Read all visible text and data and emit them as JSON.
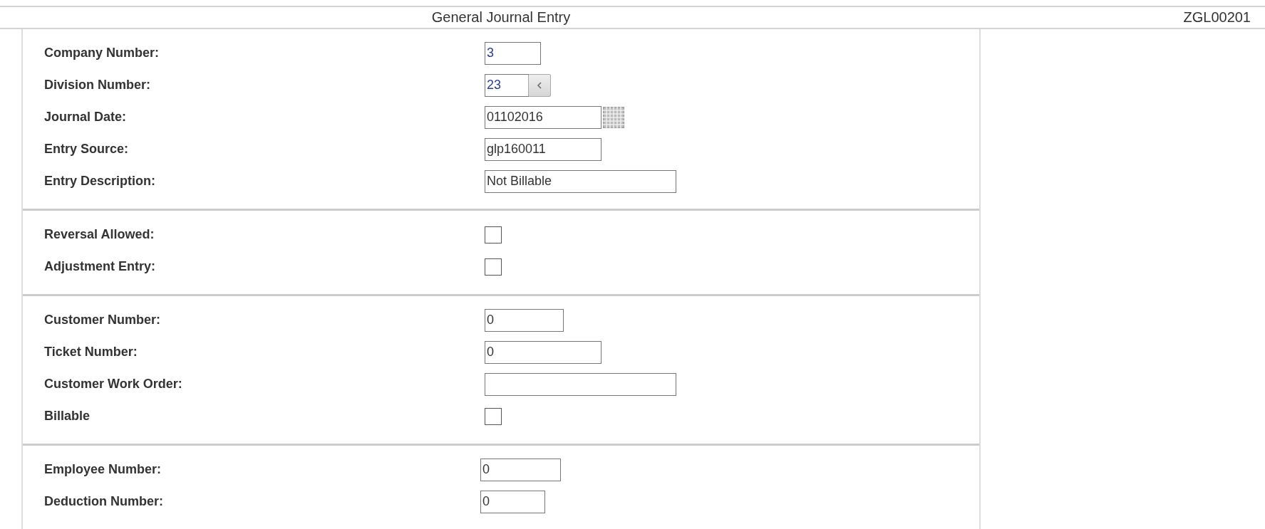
{
  "header": {
    "title": "General Journal Entry",
    "program_id": "ZGL00201"
  },
  "sections": [
    {
      "fields": [
        {
          "label": "Company Number:",
          "kind": "key",
          "value": "3"
        },
        {
          "label": "Division Number:",
          "kind": "lookup",
          "value": "23"
        },
        {
          "label": "Journal Date:",
          "kind": "date",
          "value": "01102016"
        },
        {
          "label": "Entry Source:",
          "kind": "text",
          "value": "glp160011"
        },
        {
          "label": "Entry Description:",
          "kind": "text",
          "value": "Not Billable"
        }
      ]
    },
    {
      "fields": [
        {
          "label": "Reversal Allowed:",
          "kind": "checkbox",
          "checked": false
        },
        {
          "label": "Adjustment Entry:",
          "kind": "checkbox",
          "checked": false
        }
      ]
    },
    {
      "fields": [
        {
          "label": "Customer Number:",
          "kind": "text",
          "value": "0"
        },
        {
          "label": "Ticket Number:",
          "kind": "text",
          "value": "0"
        },
        {
          "label": "Customer Work Order:",
          "kind": "text"
        },
        {
          "label": "Billable",
          "kind": "checkbox",
          "checked": false
        }
      ]
    },
    {
      "fields": [
        {
          "label": "Employee Number:",
          "kind": "text",
          "value": "0"
        },
        {
          "label": "Deduction Number:",
          "kind": "text",
          "value": "0"
        }
      ]
    }
  ]
}
